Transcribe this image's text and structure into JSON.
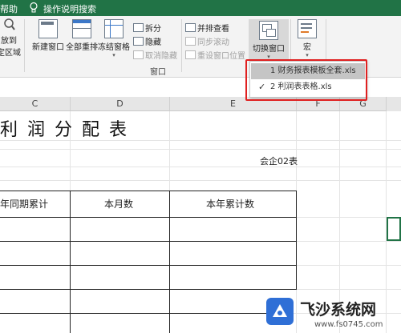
{
  "titlebar": {
    "help": "帮助",
    "search": "操作说明搜索"
  },
  "ribbon": {
    "zoom_to_selection_line1": "放到",
    "zoom_to_selection_line2": "定区域",
    "new_window": "新建窗口",
    "arrange_all": "全部重排",
    "freeze_panes": "冻结窗格",
    "split": "拆分",
    "hide": "隐藏",
    "unhide": "取消隐藏",
    "view_side_by_side": "并排查看",
    "sync_scroll": "同步滚动",
    "reset_window_position": "重设窗口位置",
    "switch_window": "切换窗口",
    "macros": "宏",
    "group_window": "窗口"
  },
  "dropdown": {
    "items": [
      {
        "label": "1 财务报表模板全套.xls",
        "checked": false
      },
      {
        "label": "2 利润表表格.xls",
        "checked": true
      }
    ]
  },
  "columns": [
    "C",
    "D",
    "E",
    "F",
    "G"
  ],
  "sheet": {
    "title": "利润分配表",
    "form_code": "会企02表",
    "headers": [
      "年同期累计",
      "本月数",
      "本年累计数"
    ]
  },
  "watermark": {
    "name": "飞沙系统网",
    "url": "www.fs0745.com"
  }
}
